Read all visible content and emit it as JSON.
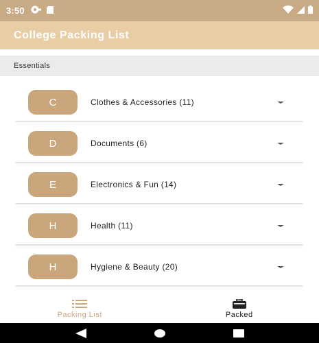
{
  "status_bar": {
    "time": "3:50",
    "left_icons": [
      "settings-icon",
      "sd-card-icon"
    ],
    "right_icons": [
      "wifi-icon",
      "signal-icon",
      "battery-icon"
    ]
  },
  "app_bar": {
    "title": "College Packing List"
  },
  "section": {
    "title": "Essentials"
  },
  "categories": [
    {
      "letter": "C",
      "label": "Clothes & Accessories (11)"
    },
    {
      "letter": "D",
      "label": "Documents (6)"
    },
    {
      "letter": "E",
      "label": "Electronics & Fun (14)"
    },
    {
      "letter": "H",
      "label": "Health (11)"
    },
    {
      "letter": "H",
      "label": "Hygiene & Beauty (20)"
    }
  ],
  "bottom_nav": {
    "items": [
      {
        "label": "Packing List",
        "icon": "list-icon",
        "active": true
      },
      {
        "label": "Packed",
        "icon": "suitcase-icon",
        "active": false
      }
    ]
  },
  "android_nav": {
    "buttons": [
      "back-icon",
      "home-icon",
      "recents-icon"
    ]
  },
  "colors": {
    "status_bar": "#c8aa85",
    "app_bar": "#e9cda5",
    "accent": "#caa67c",
    "section_bg": "#ebebeb"
  }
}
